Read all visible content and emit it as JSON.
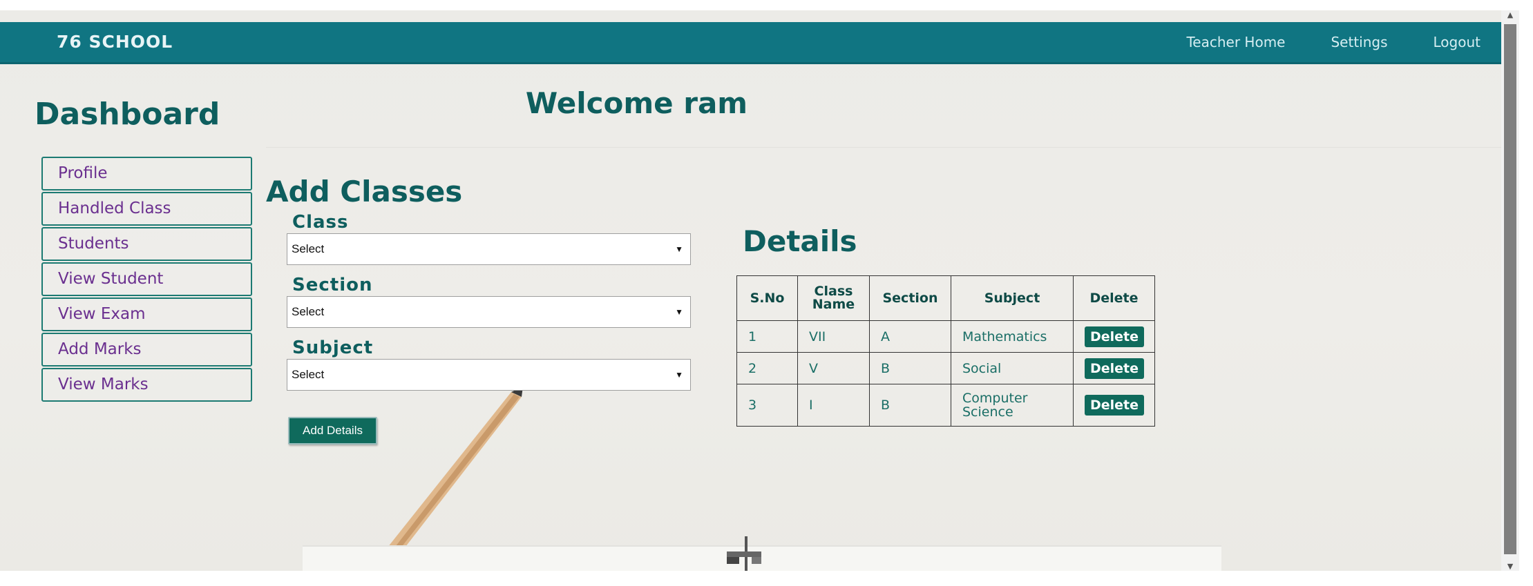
{
  "brand": "76 SCHOOL",
  "nav": [
    "Teacher Home",
    "Settings",
    "Logout"
  ],
  "dashboard_title": "Dashboard",
  "welcome": "Welcome ram",
  "sidebar": [
    "Profile",
    "Handled Class",
    "Students",
    "View Student",
    "View Exam",
    "Add Marks",
    "View Marks"
  ],
  "form": {
    "title": "Add Classes",
    "class_label": "Class",
    "class_value": "Select",
    "section_label": "Section",
    "section_value": "Select",
    "subject_label": "Subject",
    "subject_value": "Select",
    "submit": "Add Details"
  },
  "details": {
    "title": "Details",
    "columns": [
      "S.No",
      "Class Name",
      "Section",
      "Subject",
      "Delete"
    ],
    "rows": [
      {
        "sno": "1",
        "class": "VII",
        "section": "A",
        "subject": "Mathematics",
        "action": "Delete"
      },
      {
        "sno": "2",
        "class": "V",
        "section": "B",
        "subject": "Social",
        "action": "Delete"
      },
      {
        "sno": "3",
        "class": "I",
        "section": "B",
        "subject": "Computer Science",
        "action": "Delete"
      }
    ]
  },
  "icons": {
    "dropdown": "chevron-down-icon",
    "scroll_up": "scroll-up-arrow-icon",
    "scroll_down": "scroll-down-arrow-icon"
  },
  "colors": {
    "header": "#107582",
    "accent": "#0f6a5c",
    "heading": "#0e5e5e",
    "sidebar_text": "#6a2f8f"
  }
}
